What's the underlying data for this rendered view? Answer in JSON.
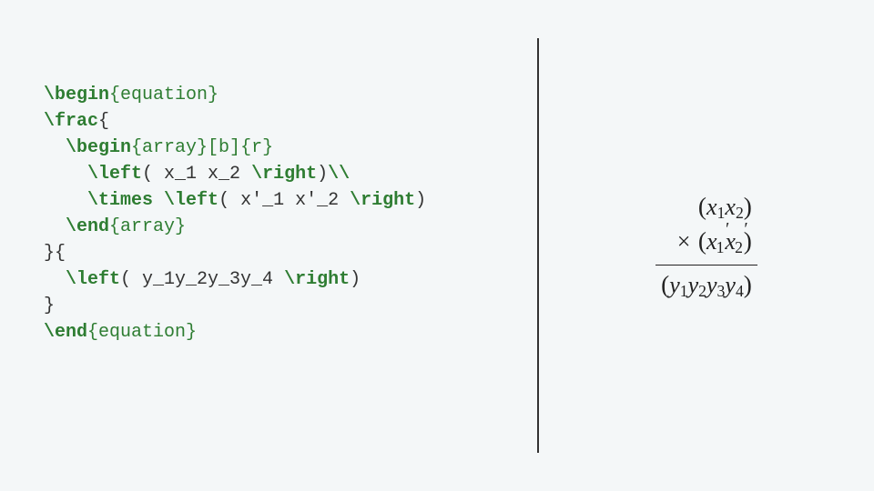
{
  "code": {
    "line1_begin": "\\begin",
    "line1_env": "{equation}",
    "line2_frac": "\\frac",
    "line2_brace": "{",
    "line3_begin": "\\begin",
    "line3_env": "{array}",
    "line3_opt": "[b]",
    "line3_arg": "{r}",
    "line4_left": "\\left",
    "line4_txt1": "( x_1 x_2 ",
    "line4_right": "\\right",
    "line4_txt2": ")",
    "line4_break": "\\\\",
    "line5_times": "\\times",
    "line5_sp": " ",
    "line5_left": "\\left",
    "line5_txt1": "( x'_1 x'_2 ",
    "line5_right": "\\right",
    "line5_txt2": ")",
    "line6_end": "\\end",
    "line6_env": "{array}",
    "line7_txt": "}{",
    "line8_left": "\\left",
    "line8_txt1": "( y_1y_2y_3y_4 ",
    "line8_right": "\\right",
    "line8_txt2": ")",
    "line9_txt": "}",
    "line10_end": "\\end",
    "line10_env": "{equation}"
  },
  "math": {
    "x": "x",
    "y": "y",
    "s1": "1",
    "s2": "2",
    "s3": "3",
    "s4": "4",
    "prime": "′",
    "lp": "(",
    "rp": ")",
    "times": "×"
  }
}
